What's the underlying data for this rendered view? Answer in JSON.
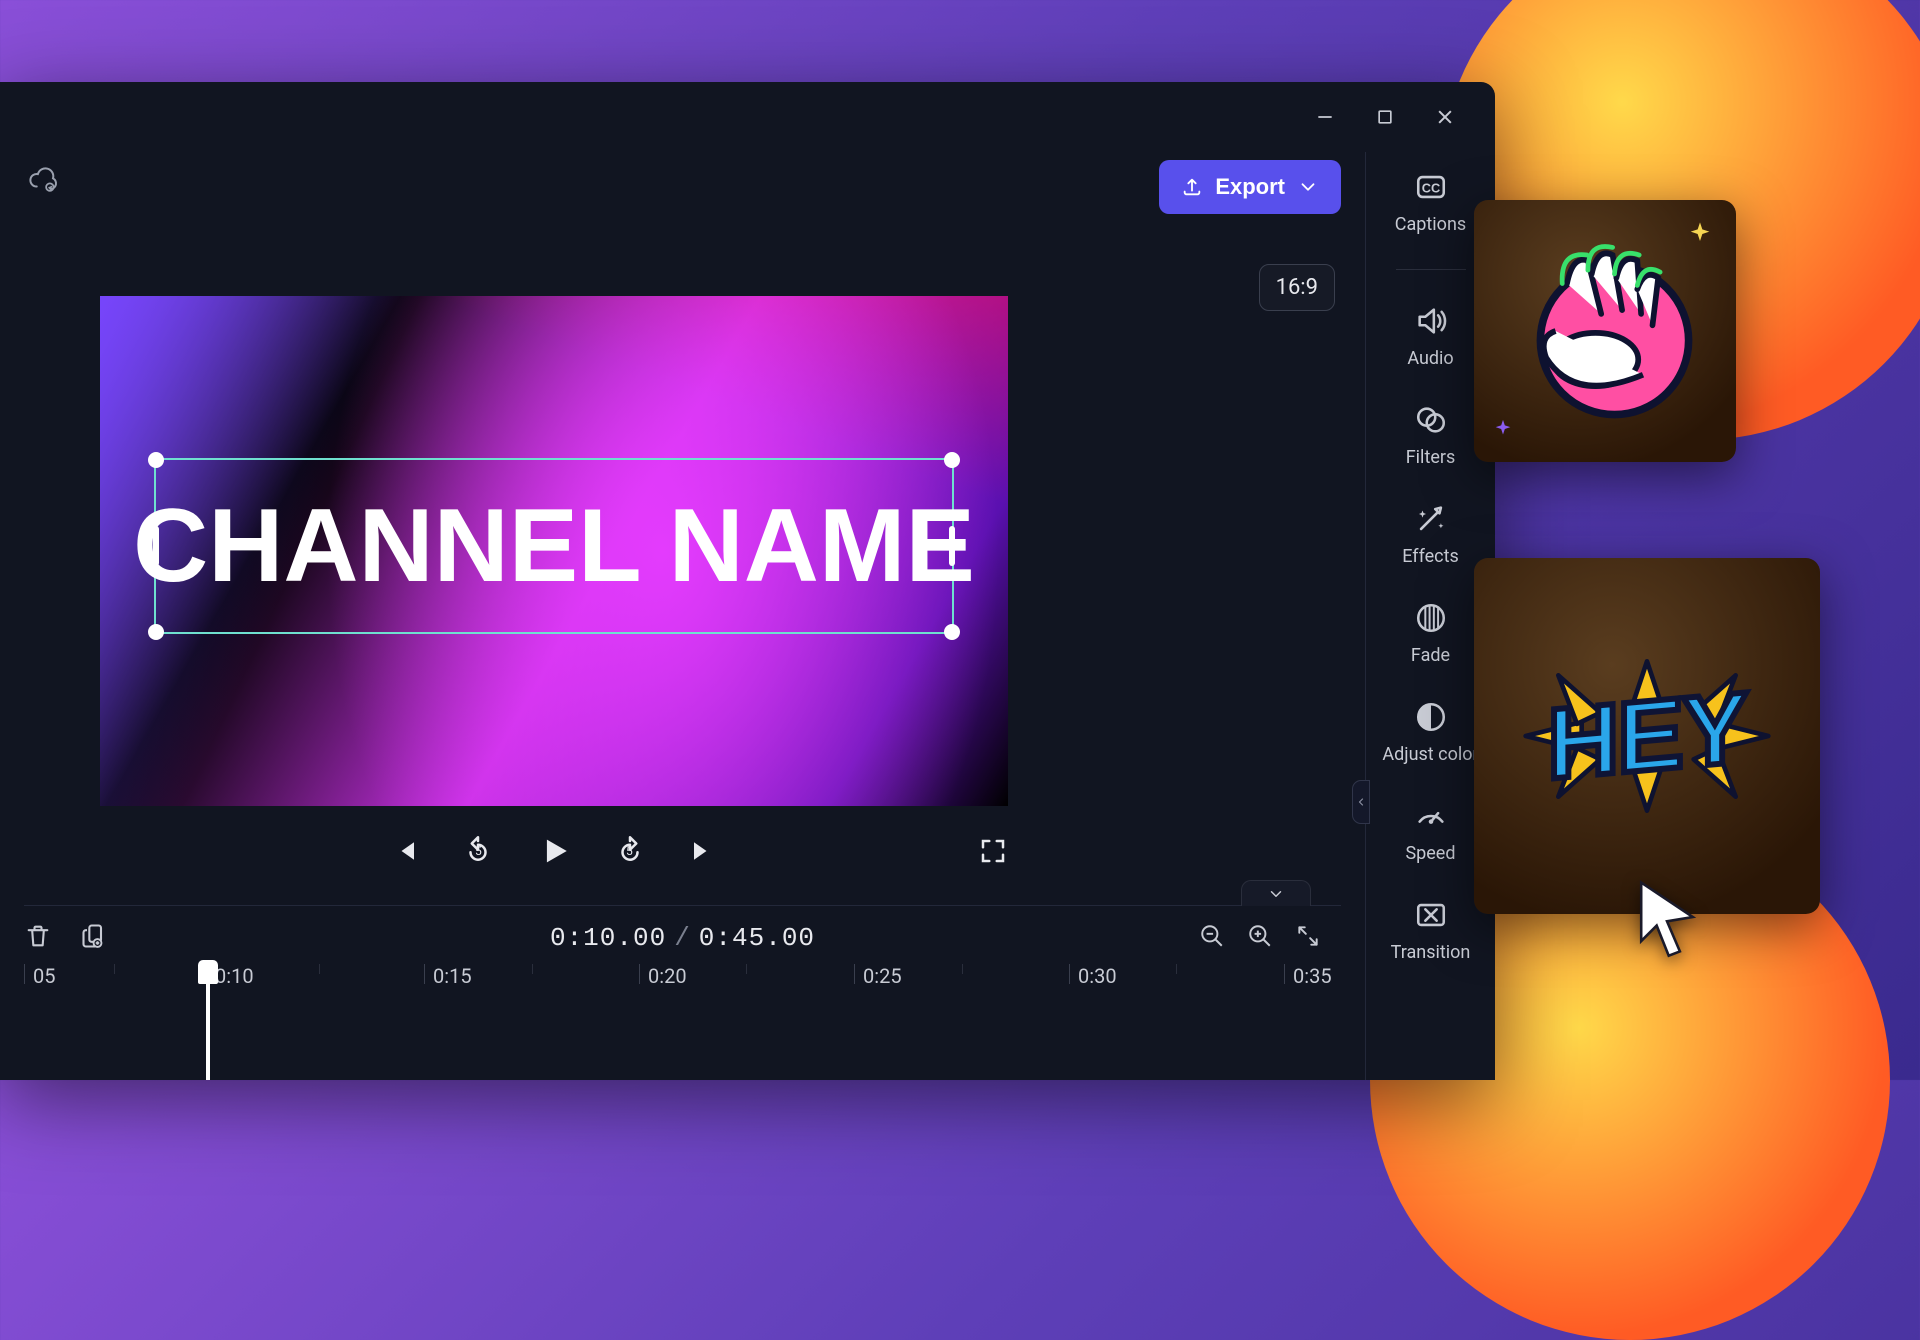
{
  "window": {
    "export_label": "Export",
    "aspect_ratio": "16:9"
  },
  "preview": {
    "text": "CHANNEL NAME"
  },
  "transport": {
    "rewind_seconds": "5",
    "forward_seconds": "5"
  },
  "timeline": {
    "current_time": "0:10.00",
    "total_time": "0:45.00",
    "ticks": [
      "05",
      "0:10",
      "0:15",
      "0:20",
      "0:25",
      "0:30",
      "0:35"
    ],
    "playhead_at": "0:10"
  },
  "sidebar": {
    "items": [
      {
        "id": "captions",
        "label": "Captions"
      },
      {
        "id": "audio",
        "label": "Audio"
      },
      {
        "id": "filters",
        "label": "Filters"
      },
      {
        "id": "effects",
        "label": "Effects"
      },
      {
        "id": "fade",
        "label": "Fade"
      },
      {
        "id": "adjust-color",
        "label": "Adjust color"
      },
      {
        "id": "speed",
        "label": "Speed"
      },
      {
        "id": "transition",
        "label": "Transition"
      }
    ]
  },
  "callouts": {
    "hey_text": "HEY"
  }
}
